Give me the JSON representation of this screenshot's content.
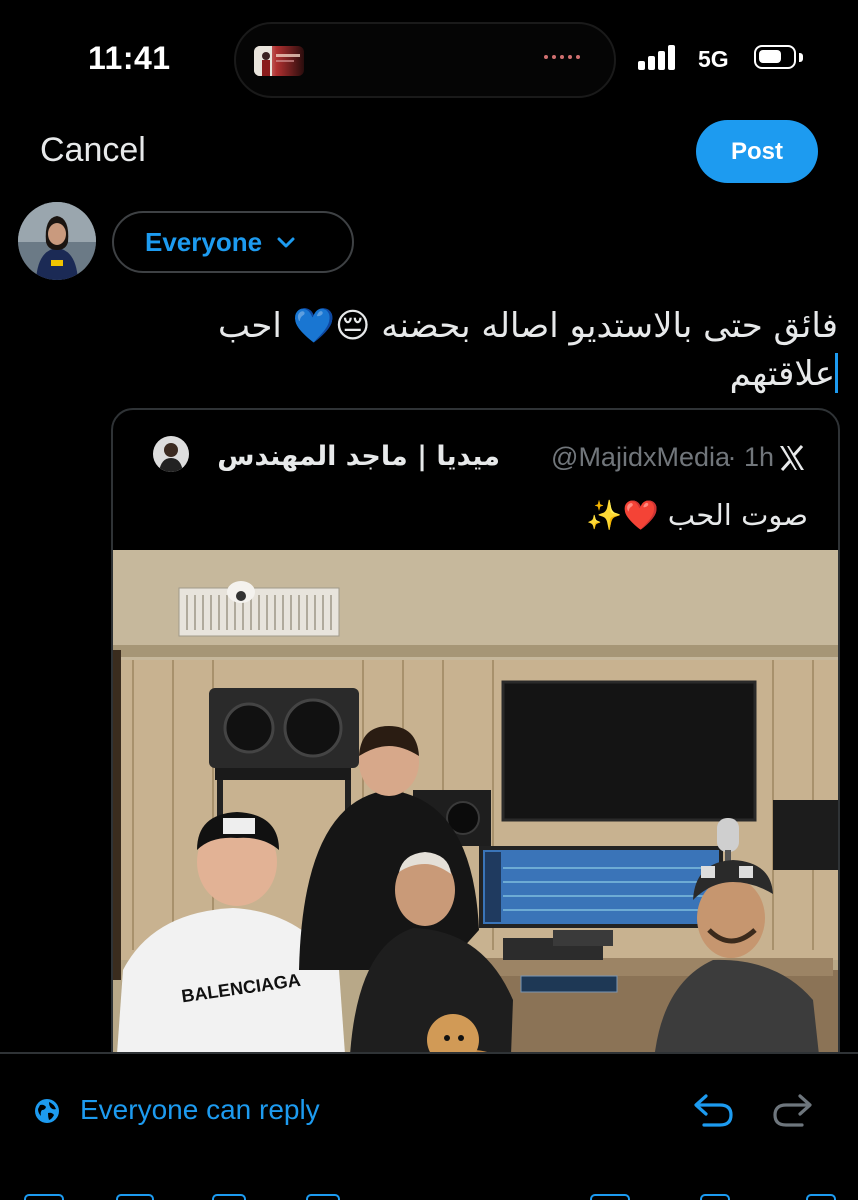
{
  "status_bar": {
    "time": "11:41",
    "network": "5G",
    "battery_level": 0.7,
    "signal_bars": 4,
    "island_app_thumb": "Pandora"
  },
  "header": {
    "cancel_label": "Cancel",
    "post_label": "Post"
  },
  "composer": {
    "audience_label": "Everyone",
    "text_line1": "فائق حتى بالاستديو اصاله بحضنه 😔💙 احب",
    "text_line2": "علاقتهم"
  },
  "quoted_post": {
    "display_name": "ميديا | ماجد المهندس",
    "handle": "@MajidxMedia",
    "time": "· 1h",
    "text": "صوت الحب ❤️✨",
    "image_description_icon": "photo-studio"
  },
  "footer": {
    "reply_setting": "Everyone can reply",
    "accent": "#1d9bf0"
  }
}
